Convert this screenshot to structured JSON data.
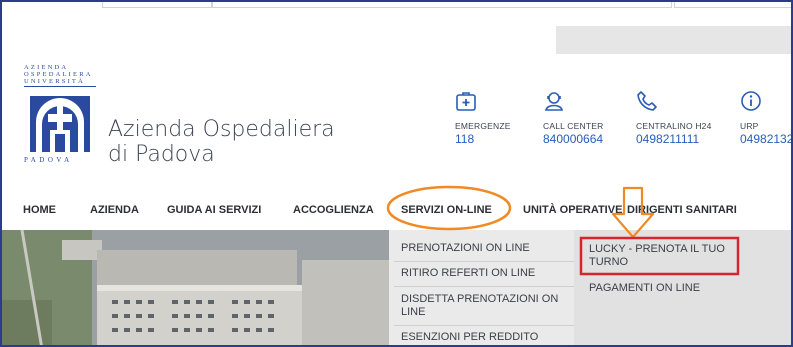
{
  "logo": {
    "top_text_lines": [
      "AZIENDA",
      "OSPEDALIERA",
      "UNIVERSITÀ"
    ],
    "bottom_text": "PADOVA",
    "icon": "hospital-arch-logo-icon"
  },
  "brand": {
    "line1": "Azienda Ospedaliera",
    "line2": "di Padova"
  },
  "contacts": [
    {
      "label": "EMERGENZE",
      "number": "118",
      "icon": "first-aid-icon"
    },
    {
      "label": "CALL CENTER",
      "number": "840000664",
      "icon": "operator-icon"
    },
    {
      "label": "CENTRALINO H24",
      "number": "0498211111",
      "icon": "phone-icon"
    },
    {
      "label": "URP",
      "number": "04982132",
      "icon": "info-icon"
    }
  ],
  "nav": {
    "items": [
      "HOME",
      "AZIENDA",
      "GUIDA AI SERVIZI",
      "ACCOGLIENZA",
      "SERVIZI ON-LINE",
      "UNITÀ OPERATIVE",
      "DIRIGENTI SANITARI"
    ]
  },
  "dropdown": {
    "col1": [
      "PRENOTAZIONI ON LINE",
      "RITIRO REFERTI ON LINE",
      "DISDETTA PRENOTAZIONI ON LINE",
      "ESENZIONI PER REDDITO"
    ],
    "col2": [
      "LUCKY - PRENOTA IL TUO TURNO",
      "PAGAMENTI ON LINE"
    ]
  },
  "colors": {
    "frame": "#2e3a8c",
    "annotation_orange": "#f08a24",
    "highlight_red": "#d9232d",
    "brand_blue": "#2a4aa0",
    "number_blue": "#2a5cb8"
  }
}
